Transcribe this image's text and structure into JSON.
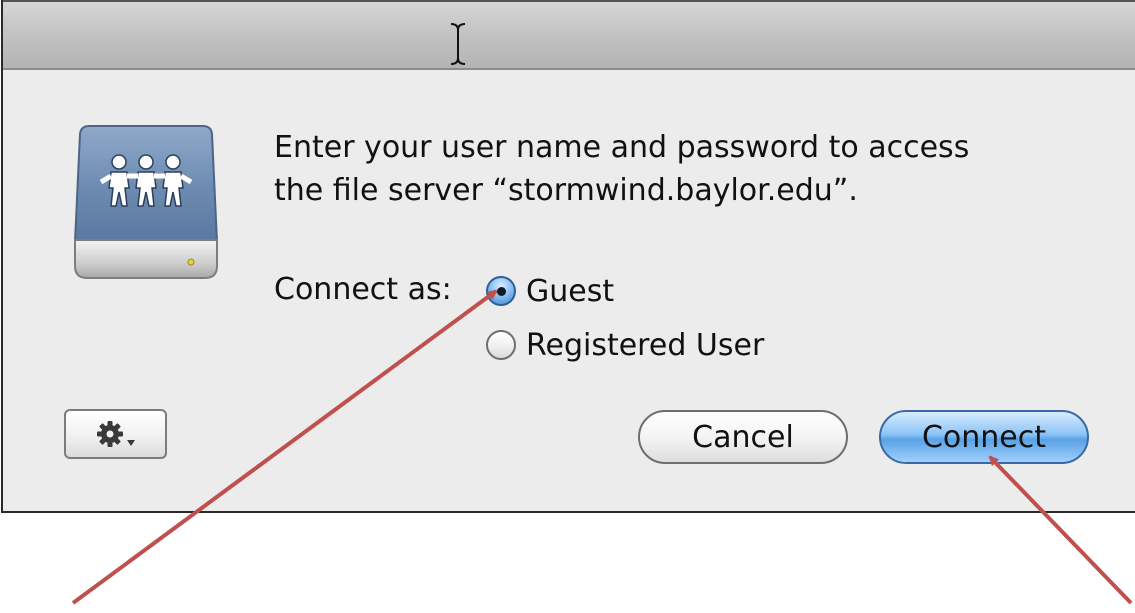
{
  "dialog": {
    "message_line1": "Enter your user name and password to access",
    "message_line2": "the file server “stormwind.baylor.edu”.",
    "connect_as_label": "Connect as:",
    "options": [
      {
        "label": "Guest",
        "selected": true
      },
      {
        "label": "Registered User",
        "selected": false
      }
    ],
    "buttons": {
      "cancel_label": "Cancel",
      "connect_label": "Connect",
      "action_menu_icon": "gear-icon"
    },
    "server_icon": "shared-file-server-icon"
  },
  "annotations": {
    "arrow_color": "#c0504d"
  },
  "colors": {
    "default_button": "#8cc3f5",
    "dialog_background": "#ececec"
  }
}
